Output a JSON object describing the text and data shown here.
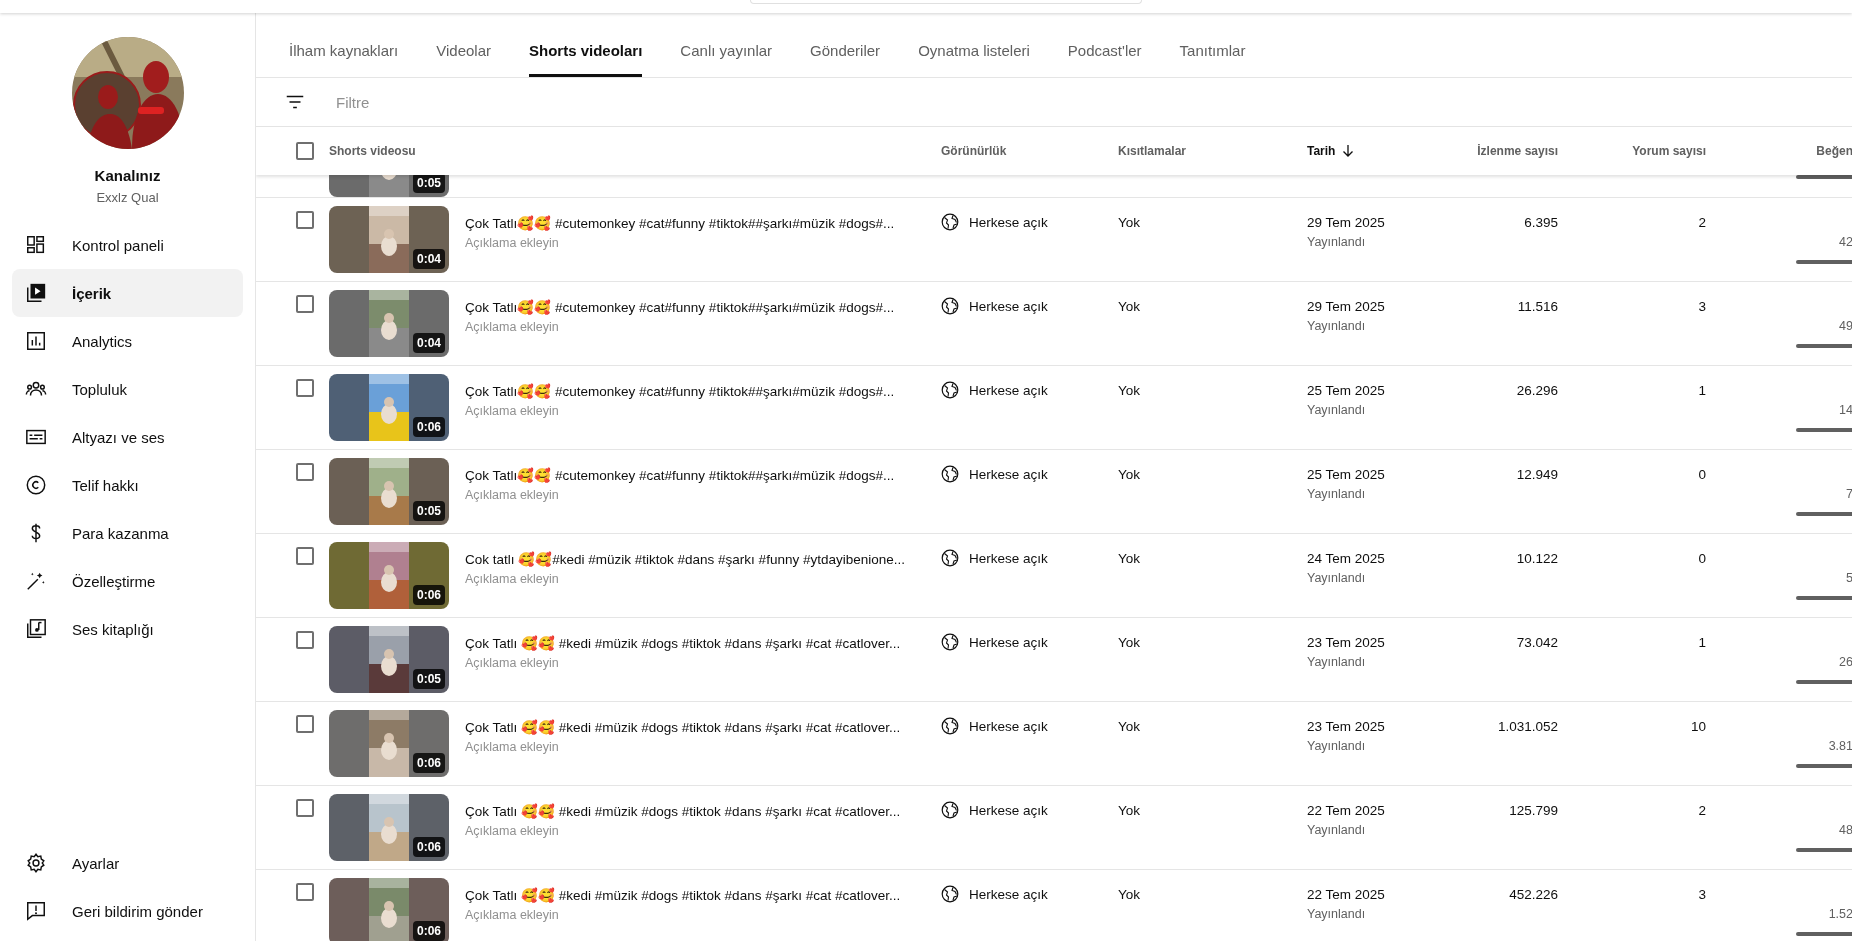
{
  "channel": {
    "title": "Kanalınız",
    "name": "Exxlz Qual"
  },
  "sidebar": {
    "items": [
      {
        "label": "Kontrol paneli",
        "kind": "dashboard",
        "selected": false
      },
      {
        "label": "İçerik",
        "kind": "content",
        "selected": true
      },
      {
        "label": "Analytics",
        "kind": "analytics",
        "selected": false
      },
      {
        "label": "Topluluk",
        "kind": "community",
        "selected": false
      },
      {
        "label": "Altyazı ve ses",
        "kind": "subtitles",
        "selected": false
      },
      {
        "label": "Telif hakkı",
        "kind": "copyright",
        "selected": false
      },
      {
        "label": "Para kazanma",
        "kind": "dollar",
        "selected": false
      },
      {
        "label": "Özelleştirme",
        "kind": "wand",
        "selected": false
      },
      {
        "label": "Ses kitaplığı",
        "kind": "music",
        "selected": false
      }
    ],
    "footer_items": [
      {
        "label": "Ayarlar",
        "kind": "gear"
      },
      {
        "label": "Geri bildirim gönder",
        "kind": "feedback"
      }
    ]
  },
  "tabs": [
    {
      "label": "İlham kaynakları",
      "selected": false
    },
    {
      "label": "Videolar",
      "selected": false
    },
    {
      "label": "Shorts videoları",
      "selected": true
    },
    {
      "label": "Canlı yayınlar",
      "selected": false
    },
    {
      "label": "Gönderiler",
      "selected": false
    },
    {
      "label": "Oynatma listeleri",
      "selected": false
    },
    {
      "label": "Podcast'ler",
      "selected": false
    },
    {
      "label": "Tanıtımlar",
      "selected": false
    }
  ],
  "filter": {
    "placeholder": "Filtre"
  },
  "table": {
    "select_all_checked": false,
    "columns": [
      {
        "label": "Shorts videosu",
        "sorted": false
      },
      {
        "label": "Görünürlük",
        "sorted": false
      },
      {
        "label": "Kısıtlamalar",
        "sorted": false
      },
      {
        "label": "Tarih",
        "sorted": true
      },
      {
        "label": "İzlenme sayısı",
        "sorted": false
      },
      {
        "label": "Yorum sayısı",
        "sorted": false
      },
      {
        "label": "Beğen",
        "sorted": false
      }
    ],
    "partial_row": {
      "duration": "0:05"
    },
    "rows": [
      {
        "checked": false,
        "duration": "0:04",
        "title": "Çok Tatlı🥰🥰 #cutemonkey #cat#funny #tiktok##şarkı#müzik #dogs#...",
        "description_hint": "Açıklama ekleyin",
        "visibility": "Herkese açık",
        "restrictions": "Yok",
        "date": "29 Tem 2025",
        "date_status": "Yayınlandı",
        "views": "6.395",
        "comments": "2",
        "likes": "42"
      },
      {
        "checked": false,
        "duration": "0:04",
        "title": "Çok Tatlı🥰🥰 #cutemonkey #cat#funny #tiktok##şarkı#müzik #dogs#...",
        "description_hint": "Açıklama ekleyin",
        "visibility": "Herkese açık",
        "restrictions": "Yok",
        "date": "29 Tem 2025",
        "date_status": "Yayınlandı",
        "views": "11.516",
        "comments": "3",
        "likes": "49"
      },
      {
        "checked": false,
        "duration": "0:06",
        "title": "Çok Tatlı🥰🥰 #cutemonkey #cat#funny #tiktok##şarkı#müzik #dogs#...",
        "description_hint": "Açıklama ekleyin",
        "visibility": "Herkese açık",
        "restrictions": "Yok",
        "date": "25 Tem 2025",
        "date_status": "Yayınlandı",
        "views": "26.296",
        "comments": "1",
        "likes": "14"
      },
      {
        "checked": false,
        "duration": "0:05",
        "title": "Çok Tatlı🥰🥰 #cutemonkey #cat#funny #tiktok##şarkı#müzik #dogs#...",
        "description_hint": "Açıklama ekleyin",
        "visibility": "Herkese açık",
        "restrictions": "Yok",
        "date": "25 Tem 2025",
        "date_status": "Yayınlandı",
        "views": "12.949",
        "comments": "0",
        "likes": "7"
      },
      {
        "checked": false,
        "duration": "0:06",
        "title": "Cok tatlı 🥰🥰#kedi #müzik #tiktok #dans #şarkı #funny #ytdayibenione...",
        "description_hint": "Açıklama ekleyin",
        "visibility": "Herkese açık",
        "restrictions": "Yok",
        "date": "24 Tem 2025",
        "date_status": "Yayınlandı",
        "views": "10.122",
        "comments": "0",
        "likes": "5"
      },
      {
        "checked": false,
        "duration": "0:05",
        "title": "Çok Tatlı 🥰🥰 #kedi #müzik #dogs #tiktok #dans #şarkı #cat #catlover...",
        "description_hint": "Açıklama ekleyin",
        "visibility": "Herkese açık",
        "restrictions": "Yok",
        "date": "23 Tem 2025",
        "date_status": "Yayınlandı",
        "views": "73.042",
        "comments": "1",
        "likes": "26"
      },
      {
        "checked": false,
        "duration": "0:06",
        "title": "Çok Tatlı 🥰🥰 #kedi #müzik #dogs #tiktok #dans #şarkı #cat #catlover...",
        "description_hint": "Açıklama ekleyin",
        "visibility": "Herkese açık",
        "restrictions": "Yok",
        "date": "23 Tem 2025",
        "date_status": "Yayınlandı",
        "views": "1.031.052",
        "comments": "10",
        "likes": "3.81"
      },
      {
        "checked": false,
        "duration": "0:06",
        "title": "Çok Tatlı 🥰🥰 #kedi #müzik #dogs #tiktok #dans #şarkı #cat #catlover...",
        "description_hint": "Açıklama ekleyin",
        "visibility": "Herkese açık",
        "restrictions": "Yok",
        "date": "22 Tem 2025",
        "date_status": "Yayınlandı",
        "views": "125.799",
        "comments": "2",
        "likes": "48"
      },
      {
        "checked": false,
        "duration": "0:06",
        "title": "Çok Tatlı 🥰🥰 #kedi #müzik #dogs #tiktok #dans #şarkı #cat #catlover...",
        "description_hint": "Açıklama ekleyin",
        "visibility": "Herkese açık",
        "restrictions": "Yok",
        "date": "22 Tem 2025",
        "date_status": "Yayınlandı",
        "views": "452.226",
        "comments": "3",
        "likes": "1.52"
      }
    ]
  }
}
